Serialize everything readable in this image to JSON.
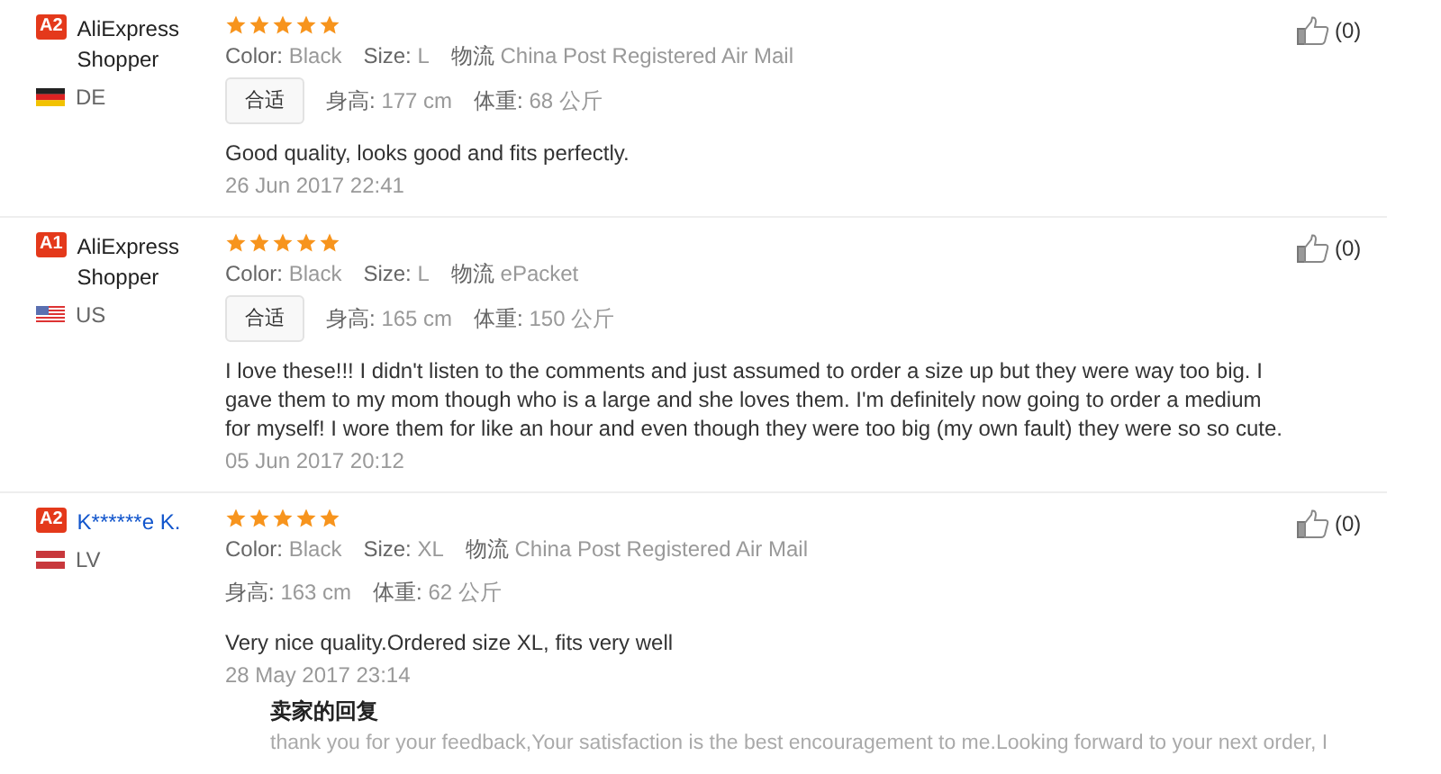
{
  "reviews": [
    {
      "badge": "A2",
      "name": "AliExpress Shopper",
      "name_link": false,
      "flag": {
        "kind": "de"
      },
      "country": "DE",
      "stars": 5,
      "attributes": [
        {
          "label": "Color:",
          "value": "Black"
        },
        {
          "label": "Size:",
          "value": "L"
        },
        {
          "label": "物流",
          "value": "China Post Registered Air Mail"
        }
      ],
      "fit_tag": "合适",
      "measurements": [
        {
          "label": "身高:",
          "value": "177 cm"
        },
        {
          "label": "体重:",
          "value": "68 公斤"
        }
      ],
      "text": "Good quality, looks good and fits perfectly.",
      "date": "26 Jun 2017 22:41",
      "likes": "(0)"
    },
    {
      "badge": "A1",
      "name": "AliExpress Shopper",
      "name_link": false,
      "flag": {
        "kind": "us"
      },
      "country": "US",
      "stars": 5,
      "attributes": [
        {
          "label": "Color:",
          "value": "Black"
        },
        {
          "label": "Size:",
          "value": "L"
        },
        {
          "label": "物流",
          "value": "ePacket"
        }
      ],
      "fit_tag": "合适",
      "measurements": [
        {
          "label": "身高:",
          "value": "165 cm"
        },
        {
          "label": "体重:",
          "value": "150 公斤"
        }
      ],
      "text": "I love these!!! I didn't listen to the comments and just assumed to order a size up but they were way too big. I gave them to my mom though who is a large and she loves them. I'm definitely now going to order a medium for myself! I wore them for like an hour and even though they were too big (my own fault) they were so so cute.",
      "date": "05 Jun 2017 20:12",
      "likes": "(0)"
    },
    {
      "badge": "A2",
      "name": "K******e K.",
      "name_link": true,
      "flag": {
        "kind": "lv"
      },
      "country": "LV",
      "stars": 5,
      "attributes": [
        {
          "label": "Color:",
          "value": "Black"
        },
        {
          "label": "Size:",
          "value": "XL"
        },
        {
          "label": "物流",
          "value": "China Post Registered Air Mail"
        }
      ],
      "measurements": [
        {
          "label": "身高:",
          "value": "163 cm"
        },
        {
          "label": "体重:",
          "value": "62 公斤"
        }
      ],
      "text": "Very nice quality.Ordered size XL, fits very well",
      "date": "28 May 2017 23:14",
      "likes": "(0)",
      "reply": {
        "title": "卖家的回复",
        "text": "thank you for your feedback,Your satisfaction is the best encouragement to me.Looking forward to your next order, I"
      }
    }
  ]
}
